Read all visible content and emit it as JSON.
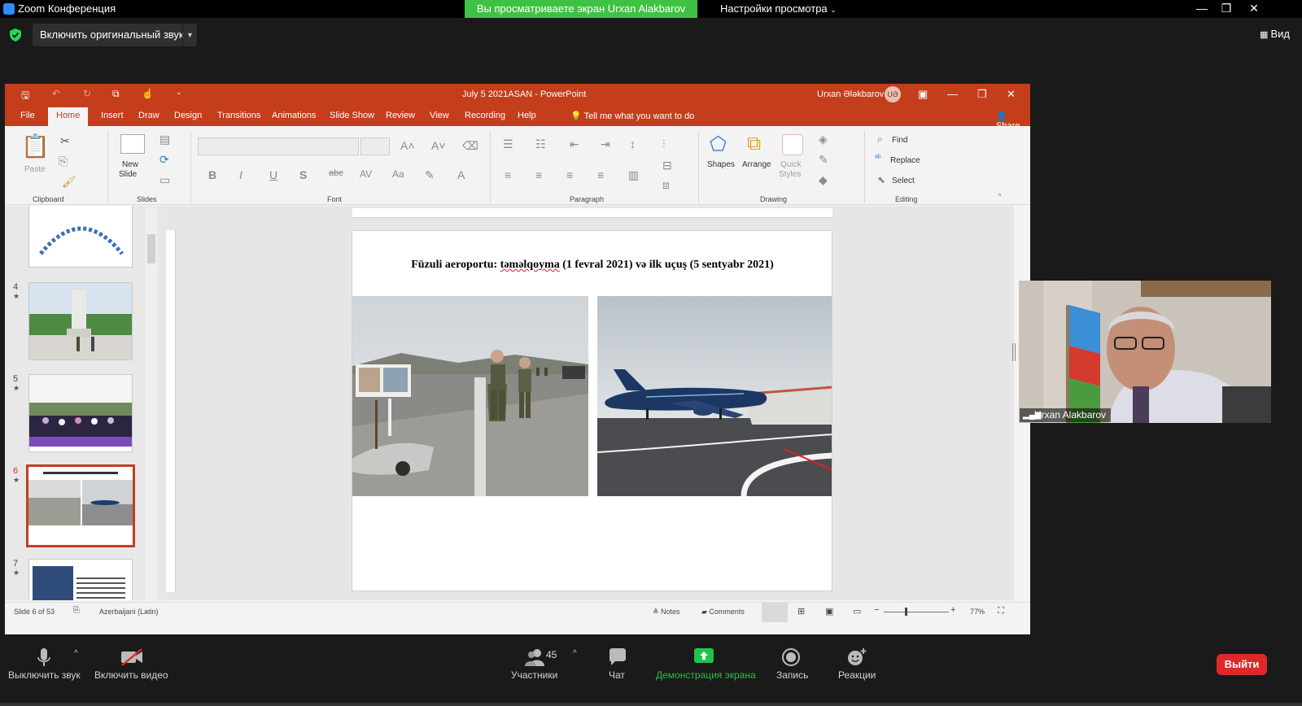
{
  "zoom": {
    "window_title": "Zoom Конференция",
    "share_banner": "Вы просматриваете экран Urxan Alakbarov",
    "view_options": "Настройки просмотра",
    "original_sound": "Включить оригинальный звук",
    "view_button": "Вид",
    "participant_name": "Urxan Alakbarov",
    "toolbar": {
      "mute": "Выключить звук",
      "video": "Включить видео",
      "participants": "Участники",
      "participants_count": "45",
      "chat": "Чат",
      "share": "Демонстрация экрана",
      "record": "Запись",
      "reactions": "Реакции",
      "leave": "Выйти"
    },
    "colors": {
      "share_green": "#3fc243",
      "leave_red": "#e02828"
    }
  },
  "powerpoint": {
    "doc_title": "July 5 2021ASAN  -  PowerPoint",
    "user_name": "Urxan Ələkbarov",
    "user_initials": "UƏ",
    "tabs": [
      "File",
      "Home",
      "Insert",
      "Draw",
      "Design",
      "Transitions",
      "Animations",
      "Slide Show",
      "Review",
      "View",
      "Recording",
      "Help"
    ],
    "active_tab": "Home",
    "tell_me": "Tell me what you want to do",
    "share": "Share",
    "ribbon": {
      "paste": "Paste",
      "new_slide_line1": "New",
      "new_slide_line2": "Slide",
      "shapes": "Shapes",
      "arrange": "Arrange",
      "quick_styles_line1": "Quick",
      "quick_styles_line2": "Styles",
      "find": "Find",
      "replace": "Replace",
      "select": "Select",
      "groups": {
        "clipboard": "Clipboard",
        "slides": "Slides",
        "font": "Font",
        "paragraph": "Paragraph",
        "drawing": "Drawing",
        "editing": "Editing"
      }
    },
    "thumbnails": [
      {
        "num": "4",
        "star": "★"
      },
      {
        "num": "5",
        "star": "★"
      },
      {
        "num": "6",
        "star": "★"
      },
      {
        "num": "7",
        "star": "★"
      }
    ],
    "slide": {
      "title_part1": "Füzuli aeroportu: ",
      "title_underlined": "təməlqoyma",
      "title_part2": " (1 fevral 2021) və ilk uçuş (5 sentyabr  2021)"
    },
    "status": {
      "slide_counter": "Slide 6 of 53",
      "language": "Azerbaijani (Latin)",
      "notes": "Notes",
      "comments": "Comments",
      "zoom_level": "77%"
    },
    "accent": "#c43e1c"
  }
}
